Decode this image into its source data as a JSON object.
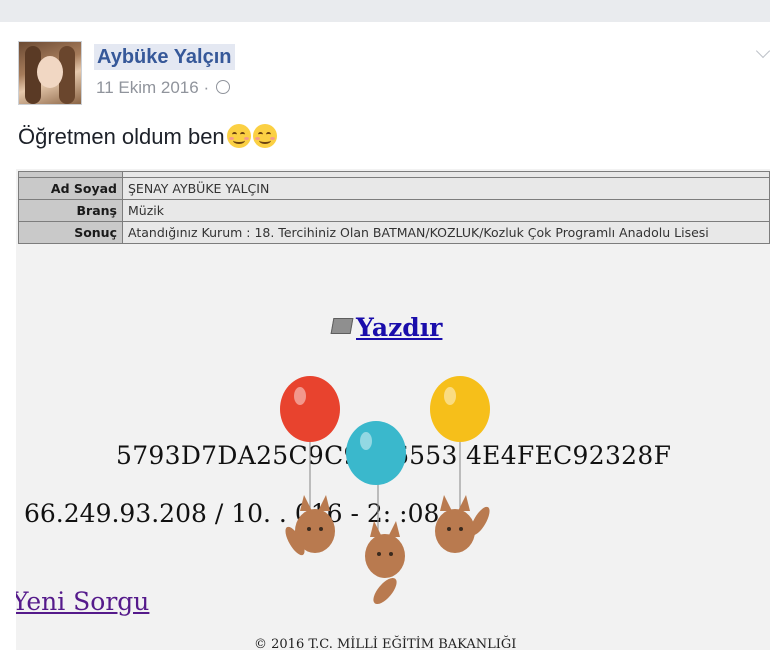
{
  "post": {
    "author_name": "Aybüke Yalçın",
    "date": "11 Ekim 2016",
    "date_separator": "·",
    "status_text": "Öğretmen oldum ben",
    "emoji_names": [
      "smiling-face-emoji",
      "smiling-face-emoji"
    ],
    "accent_color": "#365899"
  },
  "screenshot": {
    "table": [
      {
        "label": "Ad Soyad",
        "value": "ŞENAY AYBÜKE YALÇIN"
      },
      {
        "label": "Branş",
        "value": "Müzik"
      },
      {
        "label": "Sonuç",
        "value": "Atandığınız Kurum : 18. Tercihiniz Olan BATMAN/KOZLUK/Kozluk Çok Programlı Anadolu Lisesi"
      }
    ],
    "print_link": "Yazdır",
    "hash_text": "5793D7DA25C9C9_D6553 4E4FEC92328F",
    "ip_line": "66.249.93.208 / 10.  .  016 - 2: :08",
    "new_query_link": "Yeni Sorgu",
    "copyright": "© 2016 T.C. MİLLİ EĞİTİM BAKANLIĞI",
    "balloon_colors": [
      "#e8432e",
      "#3ab8cc",
      "#f6bf1a"
    ]
  }
}
